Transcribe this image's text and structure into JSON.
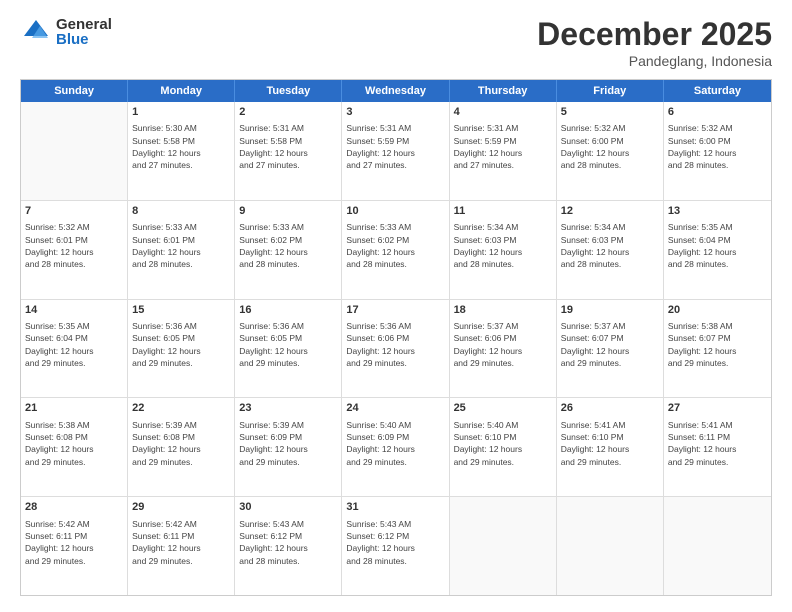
{
  "logo": {
    "general": "General",
    "blue": "Blue"
  },
  "title": "December 2025",
  "subtitle": "Pandeglang, Indonesia",
  "header_days": [
    "Sunday",
    "Monday",
    "Tuesday",
    "Wednesday",
    "Thursday",
    "Friday",
    "Saturday"
  ],
  "weeks": [
    [
      {
        "day": "",
        "info": ""
      },
      {
        "day": "1",
        "info": "Sunrise: 5:30 AM\nSunset: 5:58 PM\nDaylight: 12 hours\nand 27 minutes."
      },
      {
        "day": "2",
        "info": "Sunrise: 5:31 AM\nSunset: 5:58 PM\nDaylight: 12 hours\nand 27 minutes."
      },
      {
        "day": "3",
        "info": "Sunrise: 5:31 AM\nSunset: 5:59 PM\nDaylight: 12 hours\nand 27 minutes."
      },
      {
        "day": "4",
        "info": "Sunrise: 5:31 AM\nSunset: 5:59 PM\nDaylight: 12 hours\nand 27 minutes."
      },
      {
        "day": "5",
        "info": "Sunrise: 5:32 AM\nSunset: 6:00 PM\nDaylight: 12 hours\nand 28 minutes."
      },
      {
        "day": "6",
        "info": "Sunrise: 5:32 AM\nSunset: 6:00 PM\nDaylight: 12 hours\nand 28 minutes."
      }
    ],
    [
      {
        "day": "7",
        "info": "Sunrise: 5:32 AM\nSunset: 6:01 PM\nDaylight: 12 hours\nand 28 minutes."
      },
      {
        "day": "8",
        "info": "Sunrise: 5:33 AM\nSunset: 6:01 PM\nDaylight: 12 hours\nand 28 minutes."
      },
      {
        "day": "9",
        "info": "Sunrise: 5:33 AM\nSunset: 6:02 PM\nDaylight: 12 hours\nand 28 minutes."
      },
      {
        "day": "10",
        "info": "Sunrise: 5:33 AM\nSunset: 6:02 PM\nDaylight: 12 hours\nand 28 minutes."
      },
      {
        "day": "11",
        "info": "Sunrise: 5:34 AM\nSunset: 6:03 PM\nDaylight: 12 hours\nand 28 minutes."
      },
      {
        "day": "12",
        "info": "Sunrise: 5:34 AM\nSunset: 6:03 PM\nDaylight: 12 hours\nand 28 minutes."
      },
      {
        "day": "13",
        "info": "Sunrise: 5:35 AM\nSunset: 6:04 PM\nDaylight: 12 hours\nand 28 minutes."
      }
    ],
    [
      {
        "day": "14",
        "info": "Sunrise: 5:35 AM\nSunset: 6:04 PM\nDaylight: 12 hours\nand 29 minutes."
      },
      {
        "day": "15",
        "info": "Sunrise: 5:36 AM\nSunset: 6:05 PM\nDaylight: 12 hours\nand 29 minutes."
      },
      {
        "day": "16",
        "info": "Sunrise: 5:36 AM\nSunset: 6:05 PM\nDaylight: 12 hours\nand 29 minutes."
      },
      {
        "day": "17",
        "info": "Sunrise: 5:36 AM\nSunset: 6:06 PM\nDaylight: 12 hours\nand 29 minutes."
      },
      {
        "day": "18",
        "info": "Sunrise: 5:37 AM\nSunset: 6:06 PM\nDaylight: 12 hours\nand 29 minutes."
      },
      {
        "day": "19",
        "info": "Sunrise: 5:37 AM\nSunset: 6:07 PM\nDaylight: 12 hours\nand 29 minutes."
      },
      {
        "day": "20",
        "info": "Sunrise: 5:38 AM\nSunset: 6:07 PM\nDaylight: 12 hours\nand 29 minutes."
      }
    ],
    [
      {
        "day": "21",
        "info": "Sunrise: 5:38 AM\nSunset: 6:08 PM\nDaylight: 12 hours\nand 29 minutes."
      },
      {
        "day": "22",
        "info": "Sunrise: 5:39 AM\nSunset: 6:08 PM\nDaylight: 12 hours\nand 29 minutes."
      },
      {
        "day": "23",
        "info": "Sunrise: 5:39 AM\nSunset: 6:09 PM\nDaylight: 12 hours\nand 29 minutes."
      },
      {
        "day": "24",
        "info": "Sunrise: 5:40 AM\nSunset: 6:09 PM\nDaylight: 12 hours\nand 29 minutes."
      },
      {
        "day": "25",
        "info": "Sunrise: 5:40 AM\nSunset: 6:10 PM\nDaylight: 12 hours\nand 29 minutes."
      },
      {
        "day": "26",
        "info": "Sunrise: 5:41 AM\nSunset: 6:10 PM\nDaylight: 12 hours\nand 29 minutes."
      },
      {
        "day": "27",
        "info": "Sunrise: 5:41 AM\nSunset: 6:11 PM\nDaylight: 12 hours\nand 29 minutes."
      }
    ],
    [
      {
        "day": "28",
        "info": "Sunrise: 5:42 AM\nSunset: 6:11 PM\nDaylight: 12 hours\nand 29 minutes."
      },
      {
        "day": "29",
        "info": "Sunrise: 5:42 AM\nSunset: 6:11 PM\nDaylight: 12 hours\nand 29 minutes."
      },
      {
        "day": "30",
        "info": "Sunrise: 5:43 AM\nSunset: 6:12 PM\nDaylight: 12 hours\nand 28 minutes."
      },
      {
        "day": "31",
        "info": "Sunrise: 5:43 AM\nSunset: 6:12 PM\nDaylight: 12 hours\nand 28 minutes."
      },
      {
        "day": "",
        "info": ""
      },
      {
        "day": "",
        "info": ""
      },
      {
        "day": "",
        "info": ""
      }
    ]
  ]
}
